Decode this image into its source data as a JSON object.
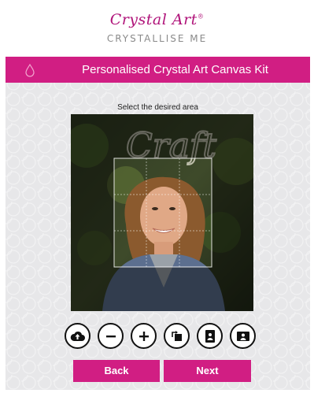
{
  "brand": {
    "name": "Crystal Art",
    "trademark": "®",
    "tagline": "CRYSTALLISE ME"
  },
  "titlebar": {
    "title": "Personalised Crystal Art Canvas Kit",
    "icon": "crystal-drop-icon"
  },
  "editor": {
    "instruction": "Select the desired area",
    "image": "portrait-photo-smiling-woman",
    "neon_sign": "Craft"
  },
  "toolbar": {
    "buttons": [
      {
        "icon": "upload-cloud-icon"
      },
      {
        "icon": "zoom-out-icon"
      },
      {
        "icon": "zoom-in-icon"
      },
      {
        "icon": "rotate-icon"
      },
      {
        "icon": "portrait-orientation-icon"
      },
      {
        "icon": "landscape-orientation-icon"
      }
    ]
  },
  "actions": {
    "back_label": "Back",
    "next_label": "Next"
  },
  "colors": {
    "accent": "#d11e83",
    "logo": "#b0147a"
  }
}
